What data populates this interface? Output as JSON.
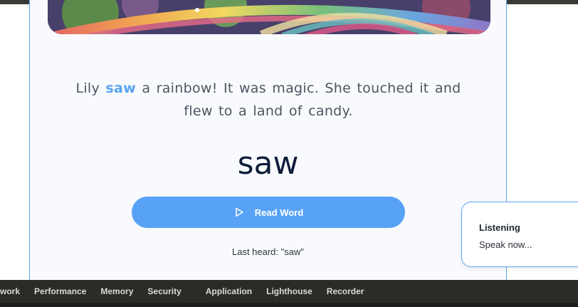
{
  "story": {
    "sentence_before": "Lily ",
    "highlighted_word": "saw",
    "sentence_after": " a rainbow! It was magic. She touched it and flew to a land of candy."
  },
  "current_word": "saw",
  "read_button": {
    "label": "Read Word",
    "icon": "play-icon"
  },
  "last_heard": "Last heard: \"saw\"",
  "toast": {
    "title": "Listening",
    "message": "Speak now..."
  },
  "devtools": {
    "tabs": [
      "work",
      "Performance",
      "Memory",
      "Security",
      "Application",
      "Lighthouse",
      "Recorder"
    ]
  },
  "colors": {
    "accent": "#58a2f6",
    "highlight": "#5aa2f2",
    "panel_border": "#5ea6f0",
    "devtools_bg": "#2b2c28"
  }
}
